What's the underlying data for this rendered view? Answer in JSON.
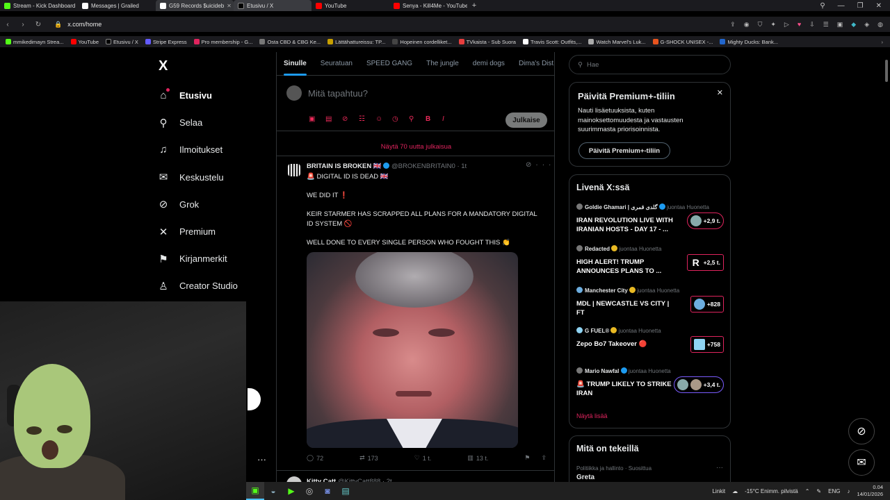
{
  "browser": {
    "tabs": [
      {
        "title": "Stream - Kick Dashboard",
        "color": "#53fc18",
        "active": false
      },
      {
        "title": "Messages | Grailed",
        "color": "#ffffff",
        "active": false
      },
      {
        "title": "G59 Records $uicideb",
        "color": "#ffffff",
        "active": true
      },
      {
        "title": "Etusivu / X",
        "color": "#000000",
        "active": false
      },
      {
        "title": "YouTube",
        "color": "#ff0000",
        "active": false
      },
      {
        "title": "Senya - Kill4Me - YouTube",
        "color": "#ff0000",
        "active": false
      }
    ],
    "url": "x.com/home",
    "bookmarks": [
      {
        "label": "mmikedimayn Strea...",
        "color": "#53fc18"
      },
      {
        "label": "YouTube",
        "color": "#ff0000"
      },
      {
        "label": "Etusivu / X",
        "color": "#000000"
      },
      {
        "label": "Stripe Express",
        "color": "#635bff"
      },
      {
        "label": "Pro membership - G...",
        "color": "#e0245e"
      },
      {
        "label": "Osta CBD & CBG Ke...",
        "color": "#777777"
      },
      {
        "label": "Lättähattureissu: TP...",
        "color": "#c8a000"
      },
      {
        "label": "Hopeinen cordelliket...",
        "color": "#444444"
      },
      {
        "label": "TVkaista - Sub Suora",
        "color": "#e83e3e"
      },
      {
        "label": "Travis Scott: Outfits,...",
        "color": "#ffffff"
      },
      {
        "label": "Watch Marvel's Luk...",
        "color": "#aaaaaa"
      },
      {
        "label": "G-SHOCK UNISEX -...",
        "color": "#e8541e"
      },
      {
        "label": "Mighty Ducks: Bank...",
        "color": "#2266cc"
      }
    ]
  },
  "nav": {
    "logo": "X",
    "items": [
      {
        "label": "Etusivu",
        "icon": "home-icon",
        "glyph": "⌂"
      },
      {
        "label": "Selaa",
        "icon": "search-icon",
        "glyph": "⚲"
      },
      {
        "label": "Ilmoitukset",
        "icon": "bell-icon",
        "glyph": "🔔"
      },
      {
        "label": "Keskustelu",
        "icon": "mail-icon",
        "glyph": "✉"
      },
      {
        "label": "Grok",
        "icon": "grok-icon",
        "glyph": "⊘"
      },
      {
        "label": "Premium",
        "icon": "x-premium-icon",
        "glyph": "𝕏"
      },
      {
        "label": "Kirjanmerkit",
        "icon": "bookmark-icon",
        "glyph": "🔖"
      },
      {
        "label": "Creator Studio",
        "icon": "creator-icon",
        "glyph": "♙"
      }
    ],
    "more": "···"
  },
  "feed": {
    "tabs": [
      "Sinulle",
      "Seuratuan",
      "SPEED GANG",
      "The jungle",
      "demi dogs",
      "Dima's Dist"
    ],
    "compose_placeholder": "Mitä tapahtuu?",
    "post_button": "Julkaise",
    "show_new": "Näytä 70 uutta julkaisua",
    "post": {
      "name": "BRITAIN IS BROKEN 🇬🇧",
      "handle": "@BROKENBRITAIN0 · 1t",
      "line1": "🚨 DIGITAL ID IS DEAD 🇬🇧",
      "line2": "WE DID IT ❗",
      "line3": "KEIR STARMER HAS SCRAPPED ALL PLANS FOR A MANDATORY DIGITAL ID SYSTEM 🚫",
      "line4": "WELL DONE TO EVERY SINGLE PERSON WHO FOUGHT THIS 👏",
      "replies": "72",
      "reposts": "173",
      "likes": "1 t.",
      "views": "13 t."
    },
    "post2": {
      "name": "Kitty Catt",
      "handle": "@KittyCatt888 · 2t"
    }
  },
  "sidebar": {
    "search_placeholder": "Hae",
    "premium": {
      "title": "Päivitä Premium+-tiliin",
      "desc": "Nauti lisäetuuksista, kuten mainoksettomuudesta ja vastausten suurimmasta priorisoinnista.",
      "button": "Päivitä Premium+-tiliin"
    },
    "live": {
      "title": "Livenä X:ssä",
      "items": [
        {
          "who": "Goldie Ghamari | گلدی قمری",
          "role": "juontaa Huonetta",
          "text": "IRAN REVOLUTION LIVE WITH IRANIAN HOSTS - DAY 17 - ...",
          "count": "+2,9 t."
        },
        {
          "who": "Redacted",
          "role": "juontaa Huonetta",
          "text": "HIGH ALERT! TRUMP ANNOUNCES PLANS TO ...",
          "count": "+2,5 t."
        },
        {
          "who": "Manchester City",
          "role": "juontaa Huonetta",
          "text": "MDL | NEWCASTLE VS CITY | FT",
          "count": "+828"
        },
        {
          "who": "G FUEL®",
          "role": "juontaa Huonetta",
          "text": "Zepo Bo7 Takeover 🔴",
          "count": "+758"
        },
        {
          "who": "Mario Nawfal",
          "role": "juontaa Huonetta",
          "text": "🚨 TRUMP LIKELY TO STRIKE IRAN",
          "count": "+3,4 t."
        }
      ],
      "show_more": "Näytä lisää"
    },
    "whats": {
      "title": "Mitä on tekeillä",
      "meta": "Politiikka ja hallinto · Suosittua",
      "topic": "Greta"
    }
  },
  "taskbar": {
    "links": "Linkit",
    "weather": "-15°C  Enimm. pilvistä",
    "lang": "ENG",
    "time": "0.04",
    "date": "14/01/2026"
  }
}
